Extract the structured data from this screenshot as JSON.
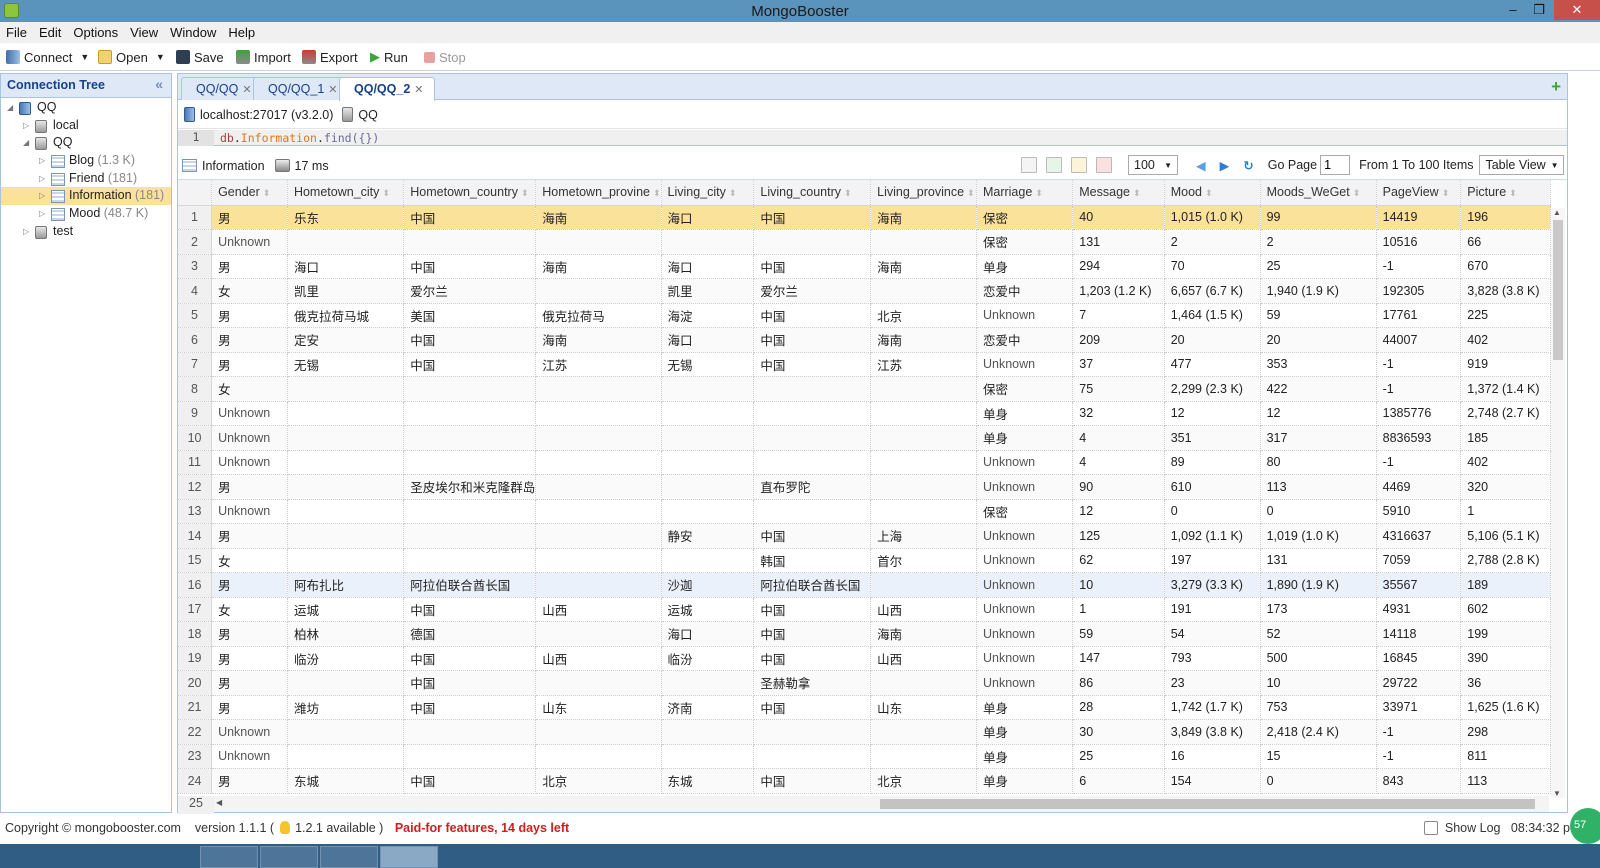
{
  "window": {
    "title": "MongoBooster",
    "minimize": "–",
    "restore": "❐",
    "close": "✕"
  },
  "menu": [
    "File",
    "Edit",
    "Options",
    "View",
    "Window",
    "Help"
  ],
  "toolbar": {
    "connect": "Connect",
    "open": "Open",
    "save": "Save",
    "import": "Import",
    "export": "Export",
    "run": "Run",
    "stop": "Stop"
  },
  "colors": {
    "accent": "#15428b",
    "selected_row": "#fbe29a",
    "titlebar": "#5a93bb",
    "warning": "#d01e1e",
    "run": "#3aa63a"
  },
  "tree": {
    "header": "Connection Tree",
    "collapse_icon": "«",
    "items": [
      {
        "label": "QQ",
        "count": "",
        "level": 0,
        "expanded": true,
        "type": "server"
      },
      {
        "label": "local",
        "count": "",
        "level": 1,
        "expanded": false,
        "type": "db"
      },
      {
        "label": "QQ",
        "count": "",
        "level": 1,
        "expanded": true,
        "type": "db"
      },
      {
        "label": "Blog",
        "count": "(1.3 K)",
        "level": 2,
        "expanded": false,
        "type": "collection"
      },
      {
        "label": "Friend",
        "count": "(181)",
        "level": 2,
        "expanded": false,
        "type": "collection"
      },
      {
        "label": "Information",
        "count": "(181)",
        "level": 2,
        "expanded": false,
        "type": "collection",
        "selected": true
      },
      {
        "label": "Mood",
        "count": "(48.7 K)",
        "level": 2,
        "expanded": false,
        "type": "collection"
      },
      {
        "label": "test",
        "count": "",
        "level": 1,
        "expanded": false,
        "type": "db"
      }
    ]
  },
  "tabs": [
    {
      "label": "QQ/QQ",
      "active": false
    },
    {
      "label": "QQ/QQ_1",
      "active": false
    },
    {
      "label": "QQ/QQ_2",
      "active": true
    }
  ],
  "connection": {
    "host": "localhost:27017 (v3.2.0)",
    "db": "QQ"
  },
  "editor": {
    "line": "1",
    "code_db": "db",
    "code_coll": "Information",
    "code_fn": "find",
    "code_args": "({})"
  },
  "result": {
    "collection": "Information",
    "time": "17 ms",
    "page_size": "100",
    "go_page_label": "Go Page",
    "page": "1",
    "range": "From 1 To 100 Items",
    "view": "Table View"
  },
  "table": {
    "columns": [
      "Gender",
      "Hometown_city",
      "Hometown_country",
      "Hometown_provine",
      "Living_city",
      "Living_country",
      "Living_province",
      "Marriage",
      "Message",
      "Mood",
      "Moods_WeGet",
      "PageView",
      "Picture"
    ],
    "rows": [
      [
        "男",
        "乐东",
        "中国",
        "海南",
        "海口",
        "中国",
        "海南",
        "保密",
        "40",
        "1,015 (1.0 K)",
        "99",
        "14419",
        "196"
      ],
      [
        "Unknown",
        "",
        "",
        "",
        "",
        "",
        "",
        "保密",
        "131",
        "2",
        "2",
        "10516",
        "66"
      ],
      [
        "男",
        "海口",
        "中国",
        "海南",
        "海口",
        "中国",
        "海南",
        "单身",
        "294",
        "70",
        "25",
        "-1",
        "670"
      ],
      [
        "女",
        "凯里",
        "爱尔兰",
        "",
        "凯里",
        "爱尔兰",
        "",
        "恋爱中",
        "1,203 (1.2 K)",
        "6,657 (6.7 K)",
        "1,940 (1.9 K)",
        "192305",
        "3,828 (3.8 K)"
      ],
      [
        "男",
        "俄克拉荷马城",
        "美国",
        "俄克拉荷马",
        "海淀",
        "中国",
        "北京",
        "Unknown",
        "7",
        "1,464 (1.5 K)",
        "59",
        "17761",
        "225"
      ],
      [
        "男",
        "定安",
        "中国",
        "海南",
        "海口",
        "中国",
        "海南",
        "恋爱中",
        "209",
        "20",
        "20",
        "44007",
        "402"
      ],
      [
        "男",
        "无锡",
        "中国",
        "江苏",
        "无锡",
        "中国",
        "江苏",
        "Unknown",
        "37",
        "477",
        "353",
        "-1",
        "919"
      ],
      [
        "女",
        "",
        "",
        "",
        "",
        "",
        "",
        "保密",
        "75",
        "2,299 (2.3 K)",
        "422",
        "-1",
        "1,372 (1.4 K)"
      ],
      [
        "Unknown",
        "",
        "",
        "",
        "",
        "",
        "",
        "单身",
        "32",
        "12",
        "12",
        "1385776",
        "2,748 (2.7 K)"
      ],
      [
        "Unknown",
        "",
        "",
        "",
        "",
        "",
        "",
        "单身",
        "4",
        "351",
        "317",
        "8836593",
        "185"
      ],
      [
        "Unknown",
        "",
        "",
        "",
        "",
        "",
        "",
        "Unknown",
        "4",
        "89",
        "80",
        "-1",
        "402"
      ],
      [
        "男",
        "",
        "圣皮埃尔和米克隆群岛",
        "",
        "",
        "直布罗陀",
        "",
        "Unknown",
        "90",
        "610",
        "113",
        "4469",
        "320"
      ],
      [
        "Unknown",
        "",
        "",
        "",
        "",
        "",
        "",
        "保密",
        "12",
        "0",
        "0",
        "5910",
        "1"
      ],
      [
        "男",
        "",
        "",
        "",
        "静安",
        "中国",
        "上海",
        "Unknown",
        "125",
        "1,092 (1.1 K)",
        "1,019 (1.0 K)",
        "4316637",
        "5,106 (5.1 K)"
      ],
      [
        "女",
        "",
        "",
        "",
        "",
        "韩国",
        "首尔",
        "Unknown",
        "62",
        "197",
        "131",
        "7059",
        "2,788 (2.8 K)"
      ],
      [
        "男",
        "阿布扎比",
        "阿拉伯联合酋长国",
        "",
        "沙迦",
        "阿拉伯联合酋长国",
        "",
        "Unknown",
        "10",
        "3,279 (3.3 K)",
        "1,890 (1.9 K)",
        "35567",
        "189"
      ],
      [
        "女",
        "运城",
        "中国",
        "山西",
        "运城",
        "中国",
        "山西",
        "Unknown",
        "1",
        "191",
        "173",
        "4931",
        "602"
      ],
      [
        "男",
        "柏林",
        "德国",
        "",
        "海口",
        "中国",
        "海南",
        "Unknown",
        "59",
        "54",
        "52",
        "14118",
        "199"
      ],
      [
        "男",
        "临汾",
        "中国",
        "山西",
        "临汾",
        "中国",
        "山西",
        "Unknown",
        "147",
        "793",
        "500",
        "16845",
        "390"
      ],
      [
        "男",
        "",
        "中国",
        "",
        "",
        "圣赫勒拿",
        "",
        "Unknown",
        "86",
        "23",
        "10",
        "29722",
        "36"
      ],
      [
        "男",
        "潍坊",
        "中国",
        "山东",
        "济南",
        "中国",
        "山东",
        "单身",
        "28",
        "1,742 (1.7 K)",
        "753",
        "33971",
        "1,625 (1.6 K)"
      ],
      [
        "Unknown",
        "",
        "",
        "",
        "",
        "",
        "",
        "单身",
        "30",
        "3,849 (3.8 K)",
        "2,418 (2.4 K)",
        "-1",
        "298"
      ],
      [
        "Unknown",
        "",
        "",
        "",
        "",
        "",
        "",
        "单身",
        "25",
        "16",
        "15",
        "-1",
        "811"
      ],
      [
        "男",
        "东城",
        "中国",
        "北京",
        "东城",
        "中国",
        "北京",
        "单身",
        "6",
        "154",
        "0",
        "843",
        "113"
      ]
    ],
    "next_row_number": "25"
  },
  "status": {
    "copyright": "Copyright © mongobooster.com",
    "version": "version 1.1.1 (",
    "update": "1.2.1 available )",
    "trial": "Paid-for features, 14 days left",
    "show_log": "Show Log",
    "time": "08:34:32 p",
    "badge": "57"
  }
}
